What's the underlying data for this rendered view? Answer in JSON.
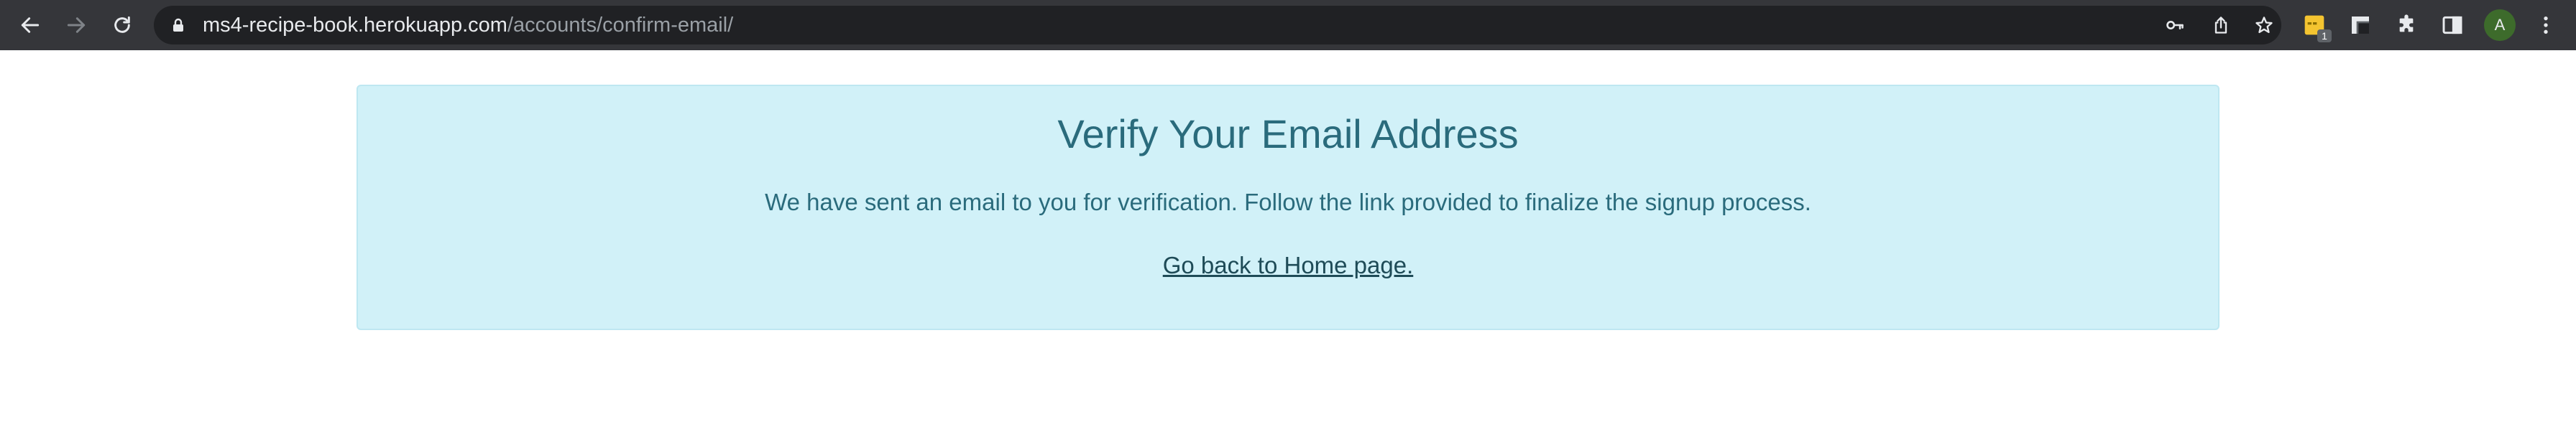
{
  "browser": {
    "url_host": "ms4-recipe-book.herokuapp.com",
    "url_path": "/accounts/confirm-email/",
    "extension_badge": "1",
    "profile_initial": "A"
  },
  "icons": {
    "back": "arrow-left-icon",
    "forward": "arrow-right-icon",
    "reload": "reload-icon",
    "lock": "lock-icon",
    "key": "key-icon",
    "share": "share-icon",
    "bookmark": "star-icon",
    "extension_sticky": "sticky-note-icon",
    "extension_frame": "frame-icon",
    "extensions": "puzzle-icon",
    "side_panel": "side-panel-icon",
    "menu": "kebab-menu-icon"
  },
  "page": {
    "title": "Verify Your Email Address",
    "message": "We have sent an email to you for verification. Follow the link provided to finalize the signup process.",
    "home_link": "Go back to Home page."
  },
  "colors": {
    "toolbar": "#35363a",
    "omnibox": "#202124",
    "alert_bg": "#d1f1f8",
    "alert_text": "#2a6b7c",
    "link_text": "#1e4b57",
    "avatar": "#3d6b2b"
  }
}
